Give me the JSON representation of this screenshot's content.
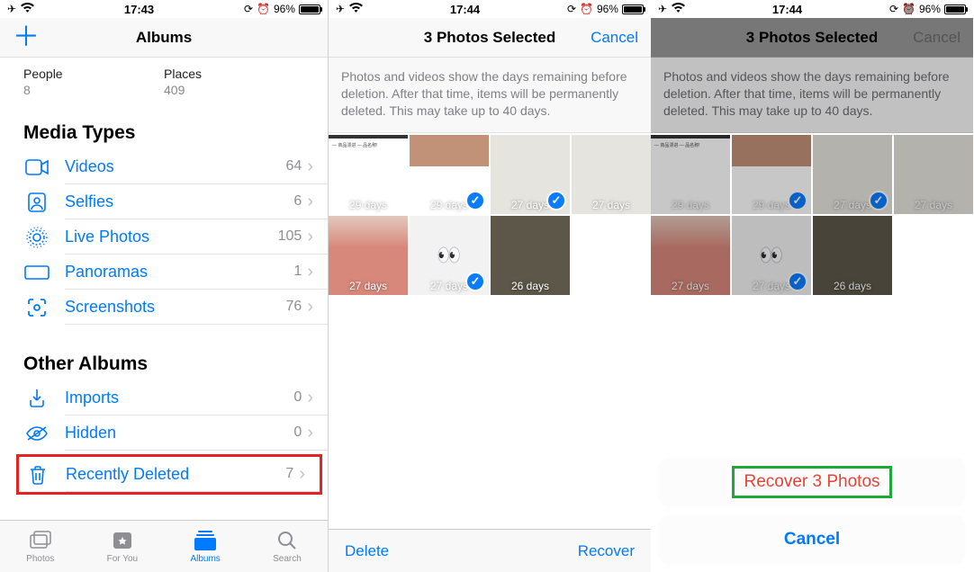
{
  "status": {
    "time1": "17:43",
    "time2": "17:44",
    "time3": "17:44",
    "battery_pct": "96%"
  },
  "panel1": {
    "title": "Albums",
    "summary": {
      "col1_label": "People",
      "col1_count": "8",
      "col2_label": "Places",
      "col2_count": "409"
    },
    "media_types_header": "Media Types",
    "media_types": [
      {
        "icon": "video",
        "label": "Videos",
        "count": "64"
      },
      {
        "icon": "selfie",
        "label": "Selfies",
        "count": "6"
      },
      {
        "icon": "live",
        "label": "Live Photos",
        "count": "105"
      },
      {
        "icon": "pano",
        "label": "Panoramas",
        "count": "1"
      },
      {
        "icon": "screenshot",
        "label": "Screenshots",
        "count": "76"
      }
    ],
    "other_header": "Other Albums",
    "other": [
      {
        "icon": "import",
        "label": "Imports",
        "count": "0"
      },
      {
        "icon": "hidden",
        "label": "Hidden",
        "count": "0"
      },
      {
        "icon": "trash",
        "label": "Recently Deleted",
        "count": "7",
        "highlighted": true
      }
    ],
    "tabs": {
      "photos": "Photos",
      "foryou": "For You",
      "albums": "Albums",
      "search": "Search"
    }
  },
  "panel2": {
    "title": "3 Photos Selected",
    "cancel": "Cancel",
    "banner": "Photos and videos show the days remaining before deletion. After that time, items will be permanently deleted. This may take up to 40 days.",
    "thumbs": [
      {
        "days": "29 days",
        "type": "text",
        "selected": false
      },
      {
        "days": "29 days",
        "type": "pink",
        "selected": true
      },
      {
        "days": "27 days",
        "type": "blanket",
        "selected": true
      },
      {
        "days": "27 days",
        "type": "blanket",
        "selected": false
      },
      {
        "days": "27 days",
        "type": "pink2",
        "selected": false
      },
      {
        "days": "27 days",
        "type": "eyes",
        "selected": true
      },
      {
        "days": "26 days",
        "type": "dark",
        "selected": false
      }
    ],
    "delete": "Delete",
    "recover": "Recover"
  },
  "panel3": {
    "title": "3 Photos Selected",
    "cancel": "Cancel",
    "recover_btn": "Recover 3 Photos",
    "sheet_cancel": "Cancel"
  }
}
